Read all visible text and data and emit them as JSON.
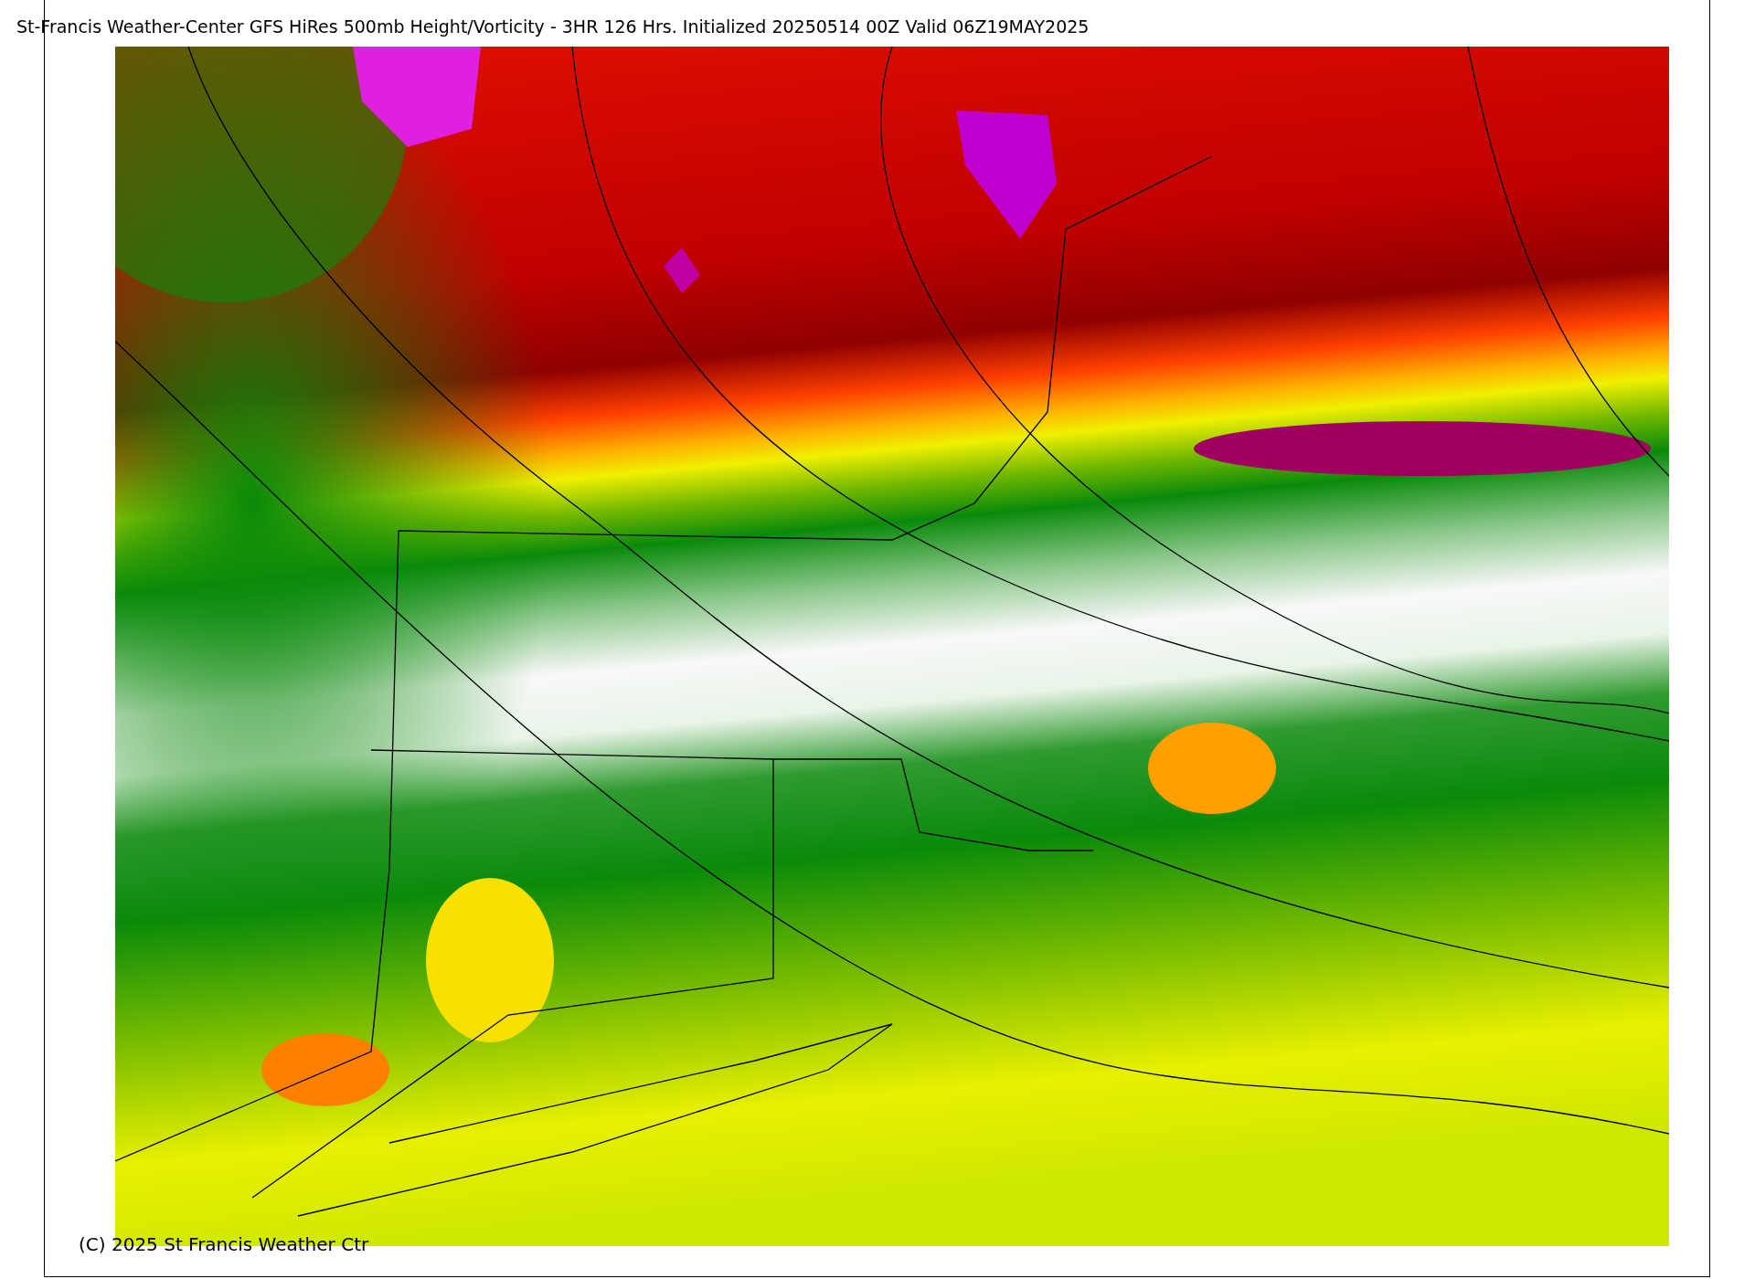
{
  "title": "St-Francis Weather-Center GFS HiRes 500mb Height/Vorticity - 3HR  126 Hrs.  Initialized 20250514 00Z Valid 06Z19MAY2025",
  "copyright": "(C) 2025 St Francis Weather Ctr"
}
